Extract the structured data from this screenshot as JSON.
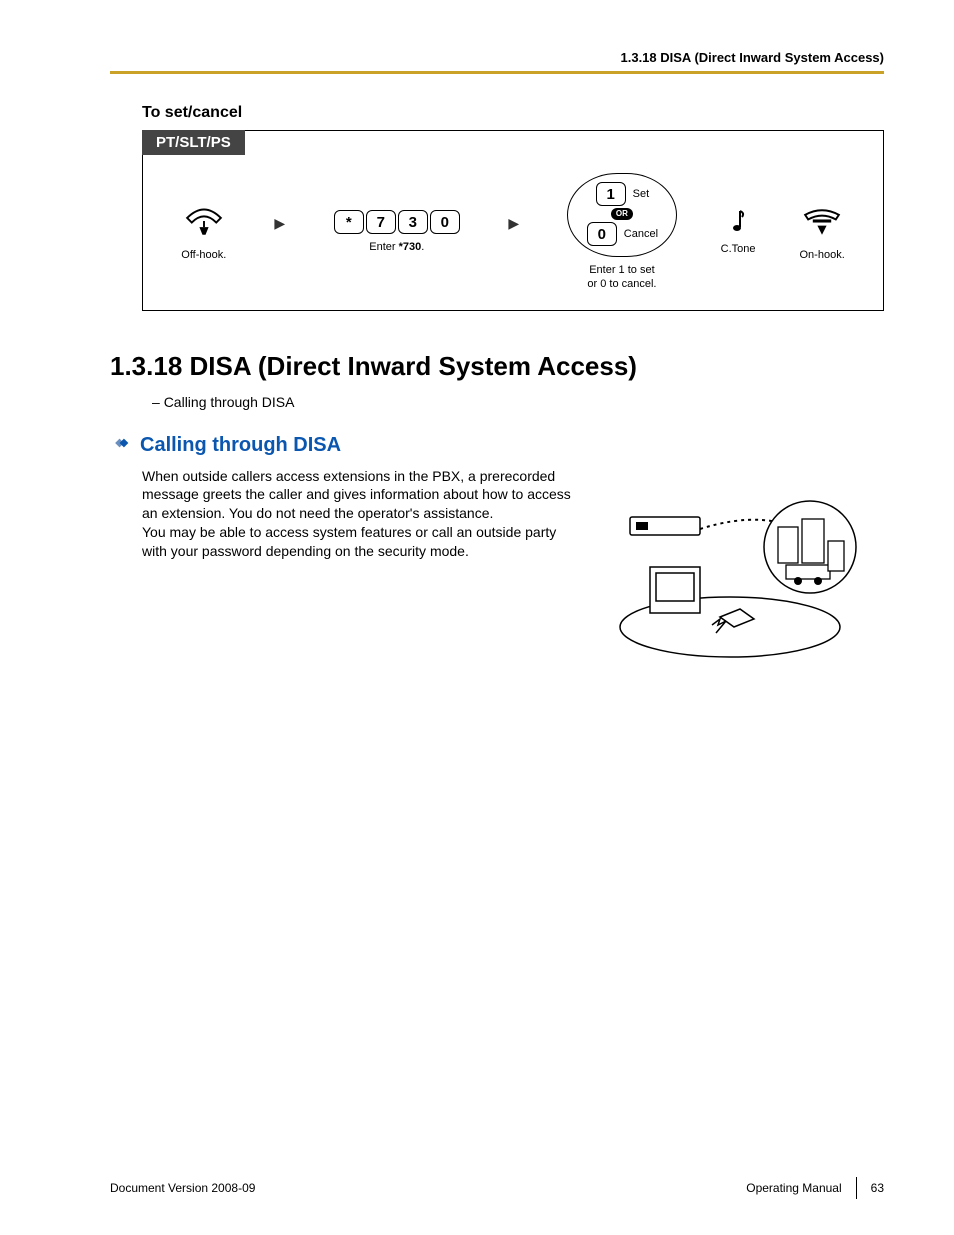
{
  "header": {
    "running_head": "1.3.18 DISA (Direct Inward System Access)"
  },
  "section_toset": {
    "title": "To set/cancel",
    "tab": "PT/SLT/PS",
    "steps": {
      "offhook": "Off-hook.",
      "dial_keys": [
        "*",
        "7",
        "3",
        "0"
      ],
      "dial_caption_prefix": "Enter ",
      "dial_caption_code": "*730",
      "dial_caption_suffix": ".",
      "choice_set_key": "1",
      "choice_set_label": "Set",
      "choice_or": "OR",
      "choice_cancel_key": "0",
      "choice_cancel_label": "Cancel",
      "choice_caption_l1": "Enter 1 to set",
      "choice_caption_l2": "or 0 to cancel.",
      "ctone": "C.Tone",
      "onhook": "On-hook."
    }
  },
  "section_main": {
    "heading": "1.3.18  DISA (Direct Inward System Access)",
    "bullet": "Calling through DISA",
    "sub_heading": "Calling through DISA",
    "para1": "When outside callers access extensions in the PBX, a prerecorded message greets the caller and gives information about how to access an extension. You do not need the operator's assistance.",
    "para2": "You may be able to access system features or call an outside party with your password depending on the security mode."
  },
  "footer": {
    "left": "Document Version  2008-09",
    "right_label": "Operating Manual",
    "page_no": "63"
  }
}
